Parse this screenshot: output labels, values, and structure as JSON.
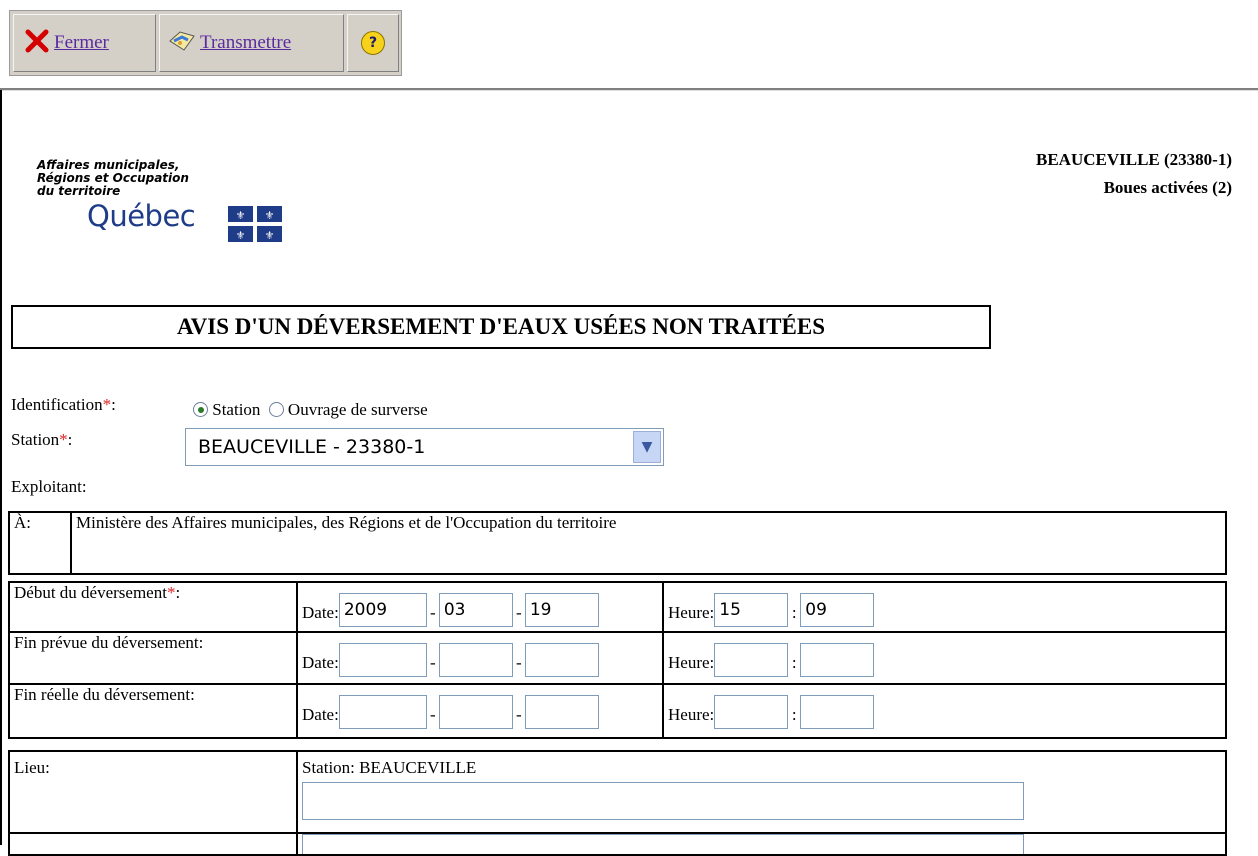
{
  "toolbar": {
    "close_label": "Fermer",
    "transmit_label": "Transmettre",
    "help_glyph": "?"
  },
  "logo": {
    "line1": "Affaires municipales,",
    "line2": "Régions et Occupation",
    "line3": "du territoire",
    "quebec": "Québec"
  },
  "header": {
    "station_id": "BEAUCEVILLE (23380-1)",
    "process": "Boues activées (2)"
  },
  "form_title": "AVIS D'UN DÉVERSEMENT D'EAUX USÉES NON TRAITÉES",
  "identification": {
    "label": "Identification",
    "required_mark": "*",
    "suffix": ":",
    "options": [
      "Station",
      "Ouvrage de surverse"
    ],
    "selected": "Station"
  },
  "station": {
    "label": "Station",
    "required_mark": "*",
    "suffix": ":",
    "value": "BEAUCEVILLE - 23380-1"
  },
  "exploitant": {
    "label": "Exploitant:"
  },
  "recipient": {
    "label": "À:",
    "value": "Ministère des Affaires municipales, des Régions et de l'Occupation du territoire"
  },
  "spill_rows": [
    {
      "label": "Début du déversement",
      "required": "*",
      "suffix": ":",
      "date_label": "Date:",
      "year": "2009",
      "month": "03",
      "day": "19",
      "time_label": "Heure:",
      "hour": "15",
      "minute": "09"
    },
    {
      "label": "Fin prévue du déversement:",
      "required": "",
      "suffix": "",
      "date_label": "Date:",
      "year": "",
      "month": "",
      "day": "",
      "time_label": "Heure:",
      "hour": "",
      "minute": ""
    },
    {
      "label": "Fin réelle du déversement:",
      "required": "",
      "suffix": "",
      "date_label": "Date:",
      "year": "",
      "month": "",
      "day": "",
      "time_label": "Heure:",
      "hour": "",
      "minute": ""
    }
  ],
  "location": {
    "label": "Lieu:",
    "value": "Station: BEAUCEVILLE",
    "input_value": ""
  },
  "colors": {
    "link": "#5a2aa0",
    "required": "#e02020",
    "quebec_blue": "#1e3c87",
    "toolbar_bg": "#d4d0c8"
  }
}
